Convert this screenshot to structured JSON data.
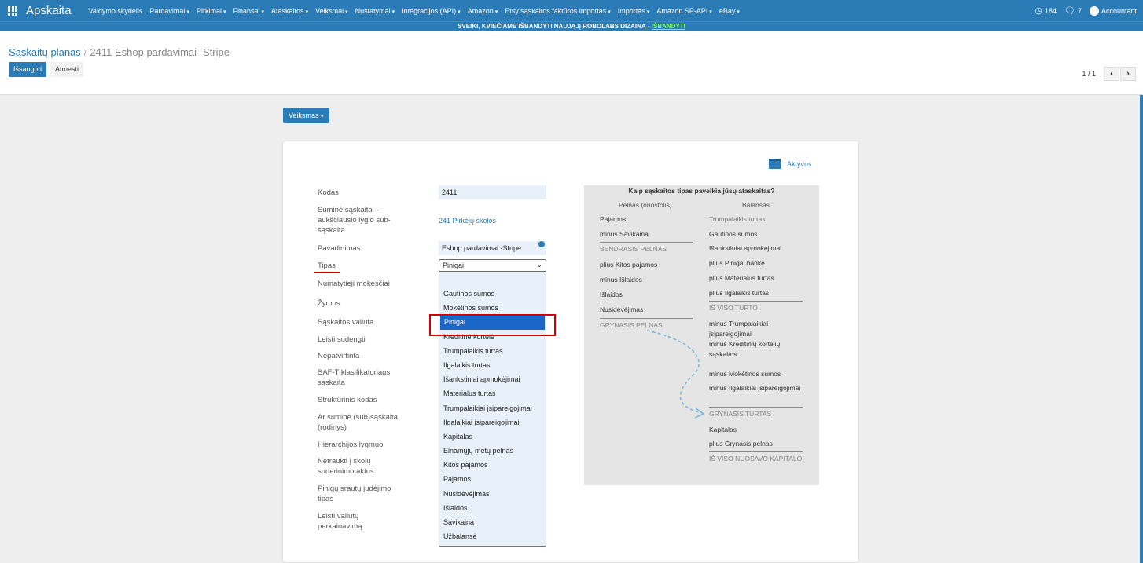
{
  "topbar": {
    "brand": "Apskaita",
    "menu": [
      {
        "label": "Valdymo skydelis",
        "caret": false
      },
      {
        "label": "Pardavimai",
        "caret": true
      },
      {
        "label": "Pirkimai",
        "caret": true
      },
      {
        "label": "Finansai",
        "caret": true
      },
      {
        "label": "Ataskaitos",
        "caret": true
      },
      {
        "label": "Veiksmai",
        "caret": true
      },
      {
        "label": "Nustatymai",
        "caret": true
      },
      {
        "label": "Integracijos (API)",
        "caret": true
      },
      {
        "label": "Amazon",
        "caret": true
      },
      {
        "label": "Etsy sąskaitos faktūros importas",
        "caret": true
      },
      {
        "label": "Importas",
        "caret": true
      },
      {
        "label": "Amazon SP-API",
        "caret": true
      },
      {
        "label": "eBay",
        "caret": true
      }
    ],
    "activity_count": "184",
    "messages_count": "7",
    "user": "Accountant"
  },
  "banner": {
    "text": "SVEIKI, KVIEČIAME IŠBANDYTI NAUJĄJĮ ROBOLABS DIZAINĄ - ",
    "link": "IŠBANDYTI"
  },
  "breadcrumb": {
    "parent": "Sąskaitų planas",
    "separator": "/",
    "current": "2411 Eshop pardavimai -Stripe"
  },
  "buttons": {
    "save": "Išsaugoti",
    "discard": "Atmesti",
    "action": "Veiksmas"
  },
  "pager": {
    "text": "1 / 1",
    "prev": "‹",
    "next": "›"
  },
  "status": {
    "active_label": "Aktyvus"
  },
  "labels": {
    "code": "Kodas",
    "parent": "Suminė sąskaita – aukščiausio lygio sub-sąskaita",
    "name": "Pavadinimas",
    "type": "Tipas",
    "taxes": "Numatytieji mokesčiai",
    "tags": "Žymos",
    "currency": "Sąskaitos valiuta",
    "reconcile": "Leisti sudengti",
    "deprecated": "Nepatvirtinta",
    "saft": "SAF-T klasifikatoriaus sąskaita",
    "structural": "Struktūrinis kodas",
    "summary_visible": "Ar suminė (sub)sąskaita (rodinys)",
    "hierarchy": "Hierarchijos lygmuo",
    "exclude_debt": "Netraukti į skolų suderinimo aktus",
    "cashflow": "Pinigų srautų judėjimo tipas",
    "revaluation": "Leisti valiutų perkainavimą"
  },
  "values": {
    "code": "2411",
    "parent": "241 Pirkėjų skolos",
    "name": "Eshop pardavimai -Stripe",
    "type": "Pinigai"
  },
  "type_options": [
    "Gautinos sumos",
    "Mokėtinos sumos",
    "Pinigai",
    "Kreditinė kortelė",
    "Trumpalaikis turtas",
    "Ilgalaikis turtas",
    "Išankstiniai apmokėjimai",
    "Materialus turtas",
    "Trumpalaikiai įsipareigojimai",
    "Ilgalaikiai įsipareigojimai",
    "Kapitalas",
    "Einamųjų metų pelnas",
    "Kitos pajamos",
    "Pajamos",
    "Nusidėvėjimas",
    "Išlaidos",
    "Savikaina",
    "Užbalansė"
  ],
  "selected_option_index": 2,
  "info": {
    "title": "Kaip sąskaitos tipas paveikia jūsų ataskaitas?",
    "pl_header": "Pelnas (nuostolis)",
    "bs_header": "Balansas",
    "pl_rows": [
      "Pajamos",
      "minus Savikaina",
      "BENDRASIS PELNAS",
      "plius Kitos pajamos",
      "minus Išlaidos",
      "Išlaidos",
      "Nusidėvėjimas",
      "GRYNASIS PELNAS"
    ],
    "bs_rows": [
      "Trumpalaikis turtas",
      "Gautinos sumos",
      "Išankstiniai apmokėjimai",
      "plius Pinigai banke",
      "plius Materialus turtas",
      "plius Ilgalaikis turtas",
      "IŠ VISO TURTO",
      "minus Trumpalaikiai įsipareigojimai",
      "minus Kreditinių kortelių sąskaitos",
      "minus Mokėtinos sumos",
      "minus Ilgalaikiai įsipareigojimai",
      "GRYNASIS TURTAS",
      "Kapitalas",
      "plius Grynasis pelnas",
      "IŠ VISO NUOSAVO KAPITALO"
    ]
  },
  "colors": {
    "primary": "#2b7cb6",
    "highlight": "#1b66c9",
    "annotation": "#d20000"
  }
}
